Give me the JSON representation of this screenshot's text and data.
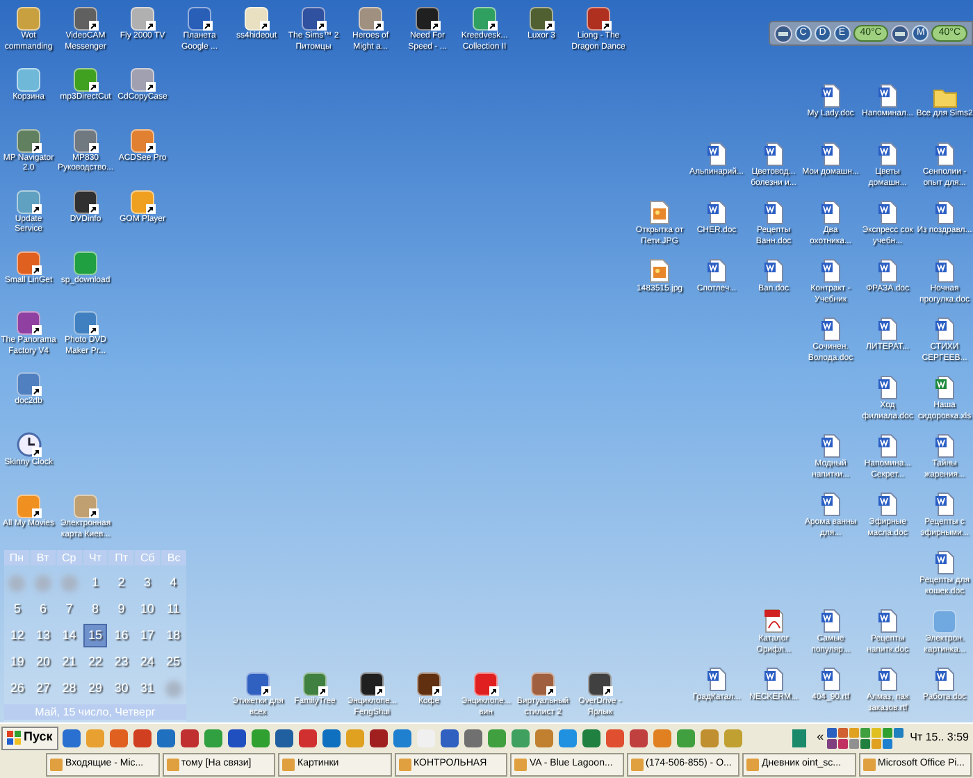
{
  "desktop": {
    "left_rows": [
      [
        {
          "label": "Wot commanding",
          "kind": "app",
          "color": "#c8a040",
          "shortcut": false
        },
        {
          "label": "VideoCAM Messenger",
          "kind": "app",
          "color": "#606060",
          "shortcut": true
        },
        {
          "label": "Fly 2000 TV",
          "kind": "app",
          "color": "#b0b0b0",
          "shortcut": true
        },
        {
          "label": "Планета Google ...",
          "kind": "app",
          "color": "#2a5fb8",
          "shortcut": true
        },
        {
          "label": "ss4hideout",
          "kind": "app",
          "color": "#e8e0c0",
          "shortcut": true
        },
        {
          "label": "The Sims™ 2 Питомцы",
          "kind": "app",
          "color": "#3050a0",
          "shortcut": true
        },
        {
          "label": "Heroes of Might a...",
          "kind": "app",
          "color": "#a09080",
          "shortcut": true
        },
        {
          "label": "Need For Speed - ...",
          "kind": "app",
          "color": "#202020",
          "shortcut": true
        },
        {
          "label": "Kreedvesk... Collection II",
          "kind": "app",
          "color": "#30a060",
          "shortcut": true
        },
        {
          "label": "Luxor 3",
          "kind": "app",
          "color": "#506030",
          "shortcut": true
        },
        {
          "label": "Liong - The Dragon Dance",
          "kind": "app",
          "color": "#b03020",
          "shortcut": true
        }
      ],
      [
        {
          "label": "Корзина",
          "kind": "app",
          "color": "#70b8d8",
          "shortcut": false
        },
        {
          "label": "mp3DirectCut",
          "kind": "app",
          "color": "#40a020",
          "shortcut": true
        },
        {
          "label": "CdCopyCase",
          "kind": "app",
          "color": "#a0a0b0",
          "shortcut": true
        }
      ],
      [
        {
          "label": "MP Navigator 2.0",
          "kind": "app",
          "color": "#608060",
          "shortcut": true
        },
        {
          "label": "MP830 Руководство...",
          "kind": "app",
          "color": "#707880",
          "shortcut": true
        },
        {
          "label": "ACDSee Pro",
          "kind": "app",
          "color": "#e08030",
          "shortcut": true
        }
      ],
      [
        {
          "label": "Update Service",
          "kind": "app",
          "color": "#60a0c0",
          "shortcut": true
        },
        {
          "label": "DVDinfo",
          "kind": "app",
          "color": "#303030",
          "shortcut": true
        },
        {
          "label": "GOM Player",
          "kind": "app",
          "color": "#f0a020",
          "shortcut": true
        }
      ],
      [
        {
          "label": "Small LinGet",
          "kind": "app",
          "color": "#e06020",
          "shortcut": true
        },
        {
          "label": "sp_download",
          "kind": "app",
          "color": "#20a040",
          "shortcut": false
        }
      ],
      [
        {
          "label": "The Panorama Factory V4",
          "kind": "app",
          "color": "#9040a0",
          "shortcut": true
        },
        {
          "label": "Photo DVD Maker Pr...",
          "kind": "app",
          "color": "#4080c0",
          "shortcut": true
        }
      ],
      [
        {
          "label": "doc2db",
          "kind": "app",
          "color": "#5080c0",
          "shortcut": true
        }
      ],
      [
        {
          "label": "Skinny Clock",
          "kind": "clock",
          "shortcut": true
        }
      ],
      [
        {
          "label": "All My Movies",
          "kind": "app",
          "color": "#f09020",
          "shortcut": true
        },
        {
          "label": "Электронная карта Киев...",
          "kind": "app",
          "color": "#c0a070",
          "shortcut": true
        }
      ]
    ],
    "bottom_icons": [
      {
        "label": "Этикетки для всех",
        "kind": "app",
        "color": "#3060c0",
        "shortcut": true
      },
      {
        "label": "FamilyTree",
        "kind": "app",
        "color": "#408040",
        "shortcut": true
      },
      {
        "label": "Энциклопе... FengShui",
        "kind": "app",
        "color": "#202020",
        "shortcut": true
      },
      {
        "label": "Кофе",
        "kind": "app",
        "color": "#603010",
        "shortcut": true
      },
      {
        "label": "Энциклопе... вин",
        "kind": "app",
        "color": "#e02020",
        "shortcut": true
      },
      {
        "label": "Виртуальный стилист 2",
        "kind": "app",
        "color": "#a06040",
        "shortcut": true
      },
      {
        "label": "OverDrive - Ярлык",
        "kind": "app",
        "color": "#404040",
        "shortcut": true
      }
    ],
    "right_rows": [
      [
        {
          "label": "My Lady.doc",
          "kind": "doc"
        },
        {
          "label": "Напоминал...",
          "kind": "doc"
        },
        {
          "label": "Все для Sims2",
          "kind": "folder"
        }
      ],
      [
        {
          "label": "Альпинарий...",
          "kind": "doc"
        },
        {
          "label": "Цветовод... болезни и...",
          "kind": "doc"
        },
        {
          "label": "Мои домашн...",
          "kind": "doc"
        },
        {
          "label": "Цветы домашн...",
          "kind": "doc"
        },
        {
          "label": "Сенполии - опыт для...",
          "kind": "doc"
        }
      ],
      [
        {
          "label": "Открытка от Пети.JPG",
          "kind": "image"
        },
        {
          "label": "CHER.doc",
          "kind": "doc"
        },
        {
          "label": "Рецепты Ванн.doc",
          "kind": "doc"
        },
        {
          "label": "Два охотника...",
          "kind": "doc"
        },
        {
          "label": "Экспресс сок учебн...",
          "kind": "doc"
        },
        {
          "label": "Из поздравл...",
          "kind": "doc"
        }
      ],
      [
        {
          "label": "1483515.jpg",
          "kind": "image"
        },
        {
          "label": "Спотлеч...",
          "kind": "doc"
        },
        {
          "label": "Ban.doc",
          "kind": "doc"
        },
        {
          "label": "Контракт - Учебник",
          "kind": "doc"
        },
        {
          "label": "ФРАЗА.doc",
          "kind": "doc"
        },
        {
          "label": "Ночная прогулка.doc",
          "kind": "doc"
        }
      ],
      [
        {
          "label": "Сочинен. Волода.doc",
          "kind": "doc"
        },
        {
          "label": "ЛИТЕРАТ...",
          "kind": "doc"
        },
        {
          "label": "СТИХИ СЕРГЕЕВ...",
          "kind": "doc"
        }
      ],
      [
        {
          "label": "Ход филиала.doc",
          "kind": "doc"
        },
        {
          "label": "Наша сидоровка.xls",
          "kind": "xls"
        }
      ],
      [
        {
          "label": "Модный напитки...",
          "kind": "doc"
        },
        {
          "label": "Напомина... Секрет...",
          "kind": "doc"
        },
        {
          "label": "Тайны жарения...",
          "kind": "doc"
        }
      ],
      [
        {
          "label": "Арома ванны для...",
          "kind": "doc"
        },
        {
          "label": "Эфирные масла.doc",
          "kind": "doc"
        },
        {
          "label": "Рецепты с эфирными...",
          "kind": "doc"
        }
      ],
      [
        {
          "label": "Рецепты для кошек.doc",
          "kind": "doc"
        }
      ],
      [
        {
          "label": "Каталог Орифл...",
          "kind": "pdf"
        },
        {
          "label": "Самые популяр...",
          "kind": "doc"
        },
        {
          "label": "Рецепты напитк.doc",
          "kind": "doc"
        },
        {
          "label": "Электрон. картинка...",
          "kind": "app",
          "color": "#70a8e0"
        }
      ],
      [
        {
          "label": "ГрадКатал...",
          "kind": "doc"
        },
        {
          "label": "NECKERM...",
          "kind": "doc"
        },
        {
          "label": "404_90.rtf",
          "kind": "doc"
        },
        {
          "label": "Алмаз, пак заказов.rtf",
          "kind": "doc"
        },
        {
          "label": "Работа.doc",
          "kind": "doc"
        }
      ]
    ]
  },
  "drive_monitor": [
    {
      "drives": [
        "C",
        "D",
        "E"
      ],
      "temperature": "40°C"
    },
    {
      "drives": [
        "M"
      ],
      "temperature": "40°C"
    }
  ],
  "calendar": {
    "weekdays": [
      "Пн",
      "Вт",
      "Ср",
      "Чт",
      "Пт",
      "Сб",
      "Вс"
    ],
    "weeks": [
      [
        {
          "kind": "empty"
        },
        {
          "kind": "empty"
        },
        {
          "kind": "empty"
        },
        {
          "day": "1",
          "selected": false
        },
        {
          "day": "2",
          "selected": false
        },
        {
          "day": "3",
          "selected": false
        },
        {
          "day": "4",
          "selected": false
        }
      ],
      [
        {
          "day": "5",
          "selected": false
        },
        {
          "day": "6",
          "selected": false
        },
        {
          "day": "7",
          "selected": false
        },
        {
          "day": "8",
          "selected": false
        },
        {
          "day": "9",
          "selected": false
        },
        {
          "day": "10",
          "selected": false
        },
        {
          "day": "11",
          "selected": false
        }
      ],
      [
        {
          "day": "12",
          "selected": false
        },
        {
          "day": "13",
          "selected": false
        },
        {
          "day": "14",
          "selected": false
        },
        {
          "day": "15",
          "selected": true
        },
        {
          "day": "16",
          "selected": false
        },
        {
          "day": "17",
          "selected": false
        },
        {
          "day": "18",
          "selected": false
        }
      ],
      [
        {
          "day": "19",
          "selected": false
        },
        {
          "day": "20",
          "selected": false
        },
        {
          "day": "21",
          "selected": false
        },
        {
          "day": "22",
          "selected": false
        },
        {
          "day": "23",
          "selected": false
        },
        {
          "day": "24",
          "selected": false
        },
        {
          "day": "25",
          "selected": false
        }
      ],
      [
        {
          "day": "26",
          "selected": false
        },
        {
          "day": "27",
          "selected": false
        },
        {
          "day": "28",
          "selected": false
        },
        {
          "day": "29",
          "selected": false
        },
        {
          "day": "30",
          "selected": false
        },
        {
          "day": "31",
          "selected": false
        },
        {
          "kind": "empty"
        }
      ]
    ],
    "footer": "Май, 15 число, Четверг"
  },
  "taskbar": {
    "start": "Пуск",
    "chevron": "«",
    "clock": "Чт 15.. 3:59",
    "tasks": [
      "Входящие - Mic...",
      "тому [На связи]",
      "Картинки",
      "КОНТРОЛЬНАЯ",
      "VA - Blue Lagoon...",
      "(174-506-855) - O...",
      "Дневник oint_sc...",
      "Microsoft Office Pi..."
    ]
  }
}
